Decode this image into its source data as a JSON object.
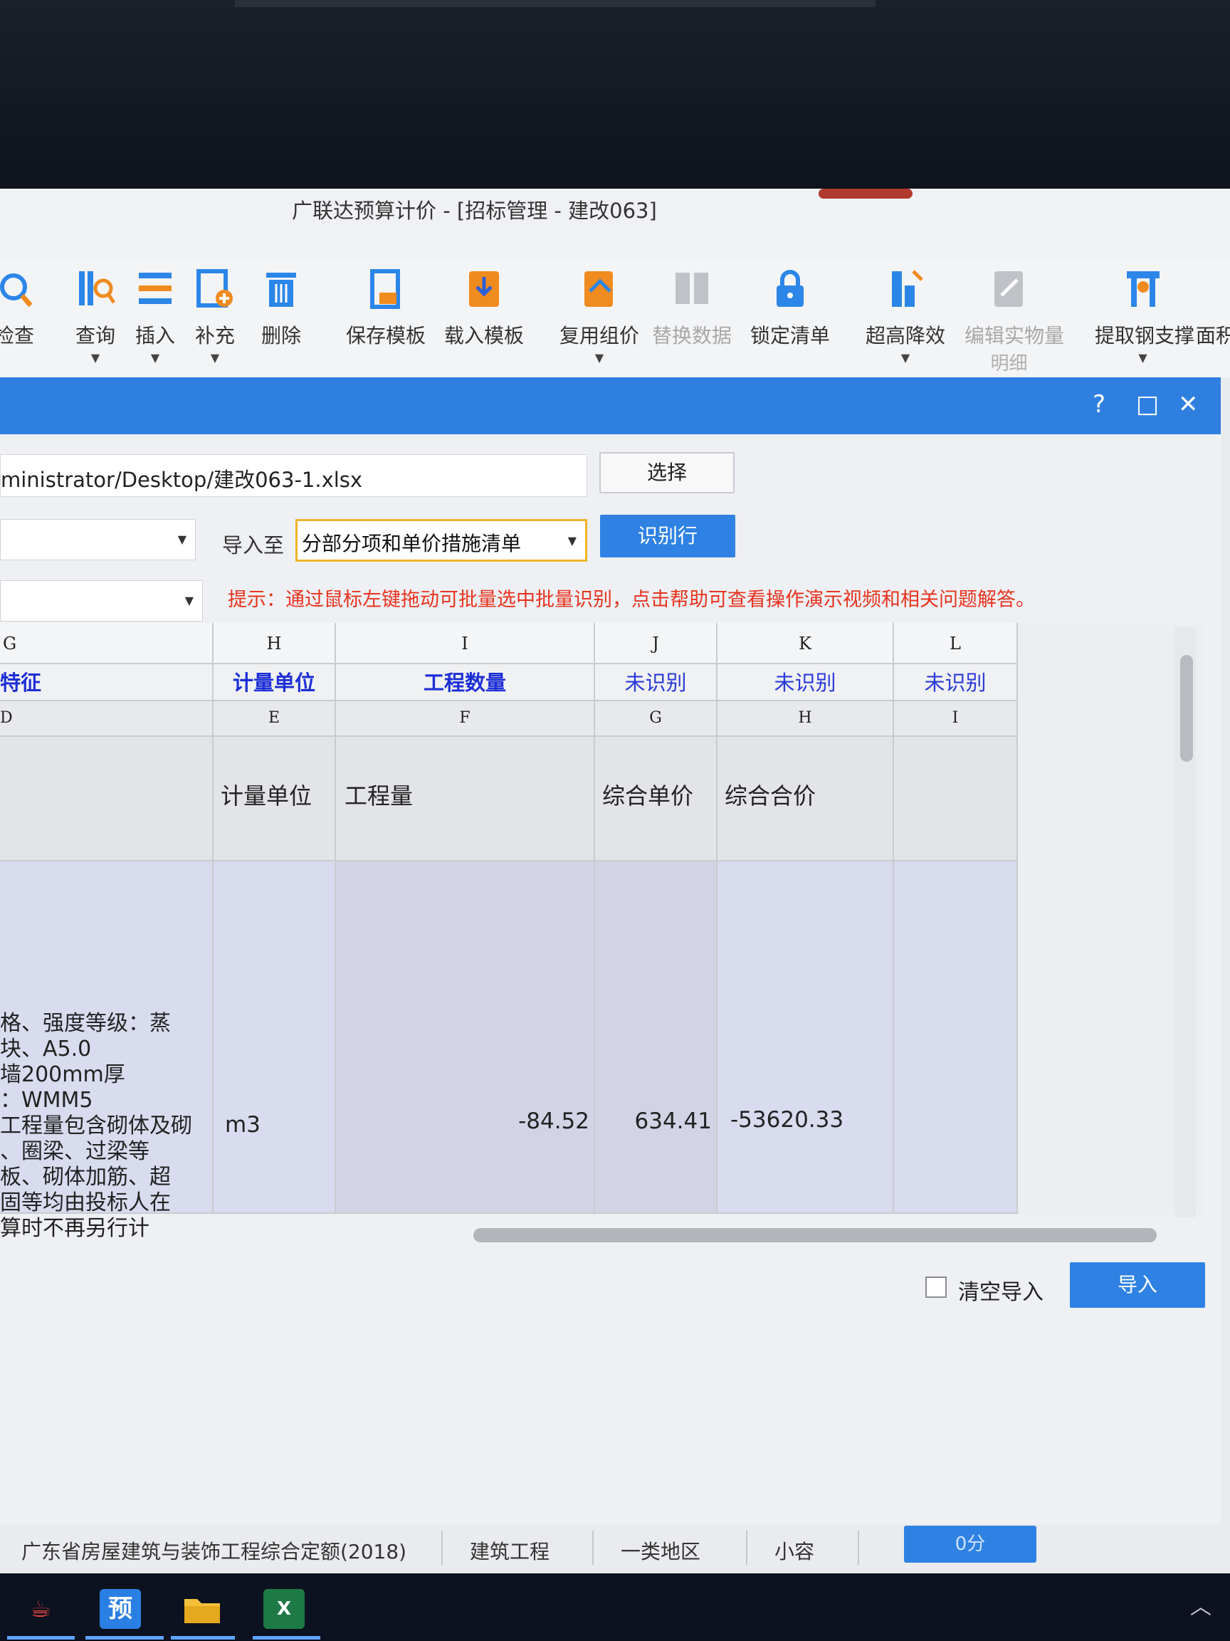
{
  "window": {
    "title": "广联达预算计价 - [招标管理 - 建改063]"
  },
  "ribbon": {
    "items": [
      {
        "label": "检查",
        "icon": "check-icon"
      },
      {
        "label": "查询",
        "icon": "query-icon"
      },
      {
        "label": "插入",
        "icon": "insert-icon"
      },
      {
        "label": "补充",
        "icon": "supplement-icon"
      },
      {
        "label": "删除",
        "icon": "delete-icon"
      },
      {
        "label": "保存模板",
        "icon": "save-template-icon"
      },
      {
        "label": "载入模板",
        "icon": "load-template-icon"
      },
      {
        "label": "复用组价",
        "icon": "reuse-price-icon"
      },
      {
        "label": "替换数据",
        "icon": "replace-data-icon"
      },
      {
        "label": "锁定清单",
        "icon": "lock-icon"
      },
      {
        "label": "超高降效",
        "icon": "height-reduction-icon"
      },
      {
        "label": "编辑实物量",
        "sublabel": "明细",
        "icon": "edit-quantity-icon"
      },
      {
        "label": "提取钢支撑",
        "icon": "steel-support-icon"
      },
      {
        "label": "面积"
      }
    ]
  },
  "dialog": {
    "file_path": "ministrator/Desktop/建改063-1.xlsx",
    "select_button": "选择",
    "import_to_label": "导入至",
    "import_to_value": "分部分项和单价措施清单",
    "identify_button": "识别行",
    "hint": "提示：通过鼠标左键拖动可批量选中批量识别，点击帮助可查看操作演示视频和相关问题解答。",
    "clear_import_label": "清空导入",
    "import_button": "导入",
    "controls": {
      "help": "?",
      "maximize": "□",
      "close": "✕"
    }
  },
  "grid": {
    "columns": [
      "G",
      "H",
      "I",
      "J",
      "K",
      "L"
    ],
    "mapping": [
      "特征",
      "计量单位",
      "工程数量",
      "未识别",
      "未识别",
      "未识别"
    ],
    "source_letters": [
      "D",
      "E",
      "F",
      "G",
      "H",
      "I"
    ],
    "header_row": [
      "",
      "计量单位",
      "工程量",
      "综合单价",
      "综合合价",
      ""
    ],
    "data_row": {
      "description": [
        "格、强度等级：蒸",
        "块、A5.0",
        "墙200mm厚",
        "：WMM5",
        "工程量包含砌体及砌",
        "、圈梁、过梁等",
        "板、砌体加筋、超",
        "固等均由投标人在",
        "算时不再另行计"
      ],
      "unit": "m3",
      "quantity": "-84.52",
      "unit_price": "634.41",
      "total_price": "-53620.33"
    }
  },
  "status_bar": {
    "items": [
      "广东省房屋建筑与装饰工程综合定额(2018)",
      "建筑工程",
      "一类地区",
      "小容"
    ],
    "score": "0分"
  },
  "taskbar": {
    "apps": [
      {
        "name": "app-icon",
        "glyph": "☕"
      },
      {
        "name": "budget-icon",
        "glyph": "预"
      },
      {
        "name": "folder-icon",
        "glyph": ""
      },
      {
        "name": "excel-icon",
        "glyph": "X"
      }
    ]
  }
}
